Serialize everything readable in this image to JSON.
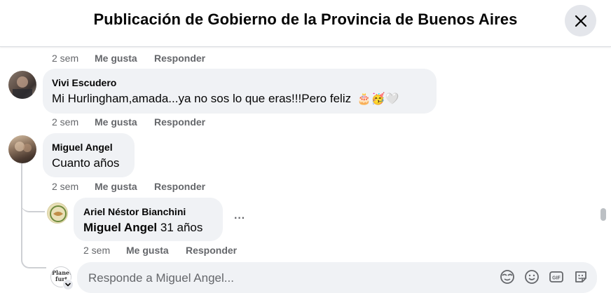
{
  "header": {
    "title": "Publicación de Gobierno de la Provincia de Buenos Aires"
  },
  "comments": [
    {
      "time": "2 sem",
      "like": "Me gusta",
      "reply": "Responder"
    },
    {
      "author": "Vivi Escudero",
      "text": "Mi Hurlingham,amada...ya no sos lo que eras!!!Pero feliz",
      "emojis": [
        "🎂",
        "🥳",
        "🤍"
      ],
      "time": "2 sem",
      "like": "Me gusta",
      "reply": "Responder"
    },
    {
      "author": "Miguel Angel",
      "text": "Cuanto años",
      "time": "2 sem",
      "like": "Me gusta",
      "reply": "Responder"
    },
    {
      "author": "Ariel Néstor Bianchini",
      "mention": "Miguel Angel",
      "text": "31 años",
      "more": "···",
      "time": "2 sem",
      "like": "Me gusta",
      "reply": "Responder"
    }
  ],
  "composer": {
    "placeholder": "Responde a Miguel Angel...",
    "avatar_text_1": "Planeta",
    "avatar_text_2": "furt"
  },
  "icons": [
    "close-icon",
    "avatar-emoji-icon",
    "emoji-icon",
    "gif-icon",
    "sticker-icon",
    "more-options-icon",
    "chevron-down-icon"
  ],
  "colors": {
    "bubble": "#f0f2f5",
    "secondary_text": "#65676b",
    "thread_line": "#ced0d4"
  }
}
